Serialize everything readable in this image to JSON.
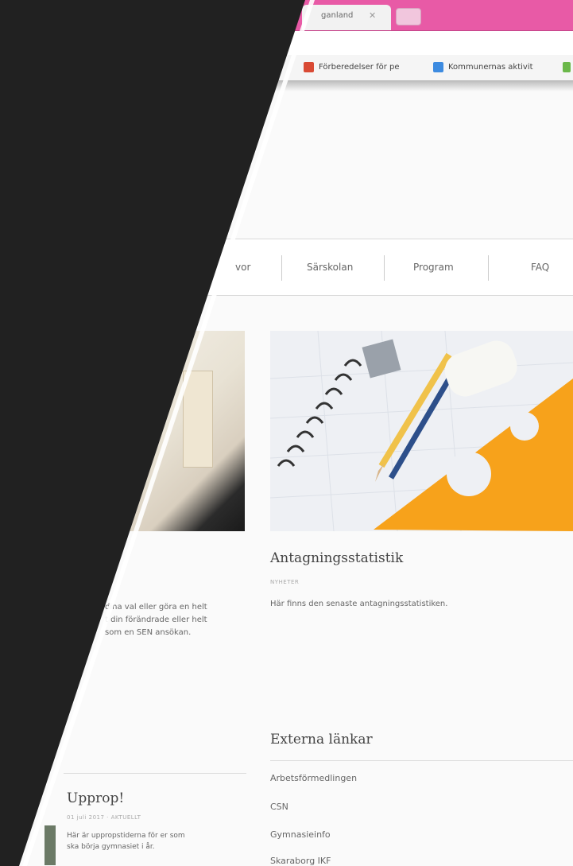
{
  "browser": {
    "tab_label": "ganland",
    "tab_close": "✕",
    "bookmarks": [
      {
        "label": "Förberedelser för pe",
        "icon": "pdf-icon",
        "color": "#d94a34"
      },
      {
        "label": "Kommunernas aktivit",
        "icon": "grid-icon",
        "color": "#3d8be0"
      },
      {
        "label": "",
        "icon": "excel-icon",
        "color": "#6bb84a"
      }
    ]
  },
  "nav": {
    "items": [
      {
        "label": "vor"
      },
      {
        "label": "Särskolan"
      },
      {
        "label": "Program"
      },
      {
        "label": "FAQ"
      }
    ]
  },
  "cards": {
    "left": {
      "lines": [
        "dina val eller göra en helt",
        "t din förändrade eller helt",
        "som en SEN ansökan."
      ]
    },
    "right": {
      "title": "Antagningsstatistik",
      "meta": "NYHETER",
      "text": "Här finns den senaste antagningsstatistiken."
    }
  },
  "external": {
    "heading": "Externa länkar",
    "links": [
      "Arbetsförmedlingen",
      "CSN",
      "Gymnasieinfo",
      "Skaraborg IKF"
    ]
  },
  "uprop": {
    "title": "Upprop!",
    "meta": "01 juli 2017 · AKTUELLT",
    "text_lines": [
      "Här är uppropstiderna för er som",
      "ska börja gymnasiet i år."
    ]
  },
  "colors": {
    "tabbar": "#e85aa6",
    "overlay": "#212121",
    "ruler": "#f7a21b"
  }
}
